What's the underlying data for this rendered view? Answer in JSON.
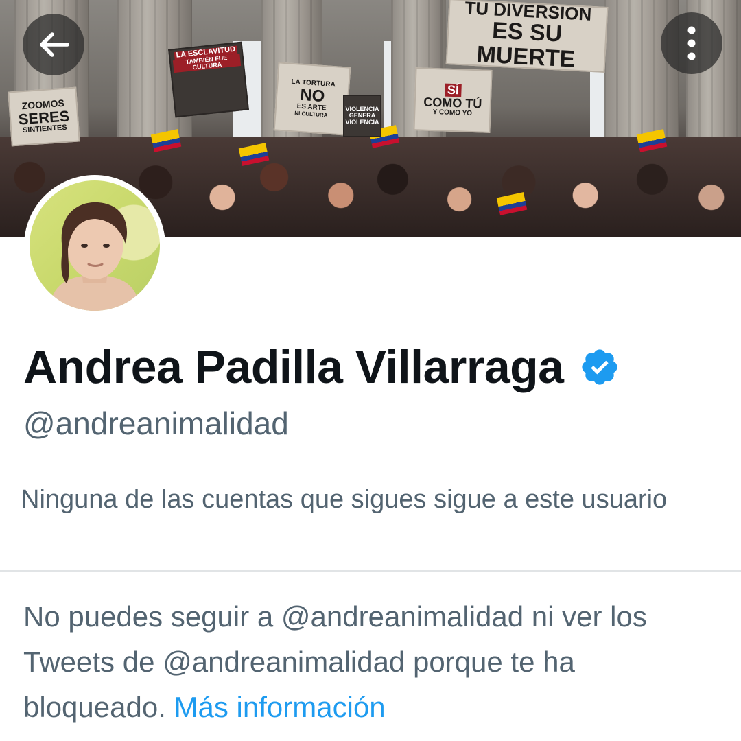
{
  "header": {
    "back_icon": "arrow-left-icon",
    "more_icon": "more-vertical-icon"
  },
  "banner": {
    "signs": [
      "TU DIVERSIÓN",
      "ES SU MUERTE",
      "LA ESCLAVITUD",
      "TAMBIÉN FUE CULTURA",
      "LA TORTURA",
      "NO",
      "ES ARTE",
      "NI CULTURA",
      "VIOLENCIA",
      "GENERA",
      "VIOLENCIA",
      "ZOOMOS",
      "SERES",
      "SINTIENTES",
      "SÍ",
      "COMO TÚ",
      "Y COMO YO"
    ]
  },
  "profile": {
    "name": "Andrea Padilla Villarraga",
    "verified": true,
    "handle": "@andreanimalidad",
    "followed_by_note": "Ninguna de las cuentas que sigues sigue a este usuario"
  },
  "blocked": {
    "message": "No puedes seguir a @andreanimalidad ni ver los Tweets de @andreanimalidad porque te ha bloqueado.",
    "link_label": "Más información"
  },
  "colors": {
    "text_primary": "#0f1419",
    "text_secondary": "#536471",
    "accent": "#1d9bf0"
  }
}
